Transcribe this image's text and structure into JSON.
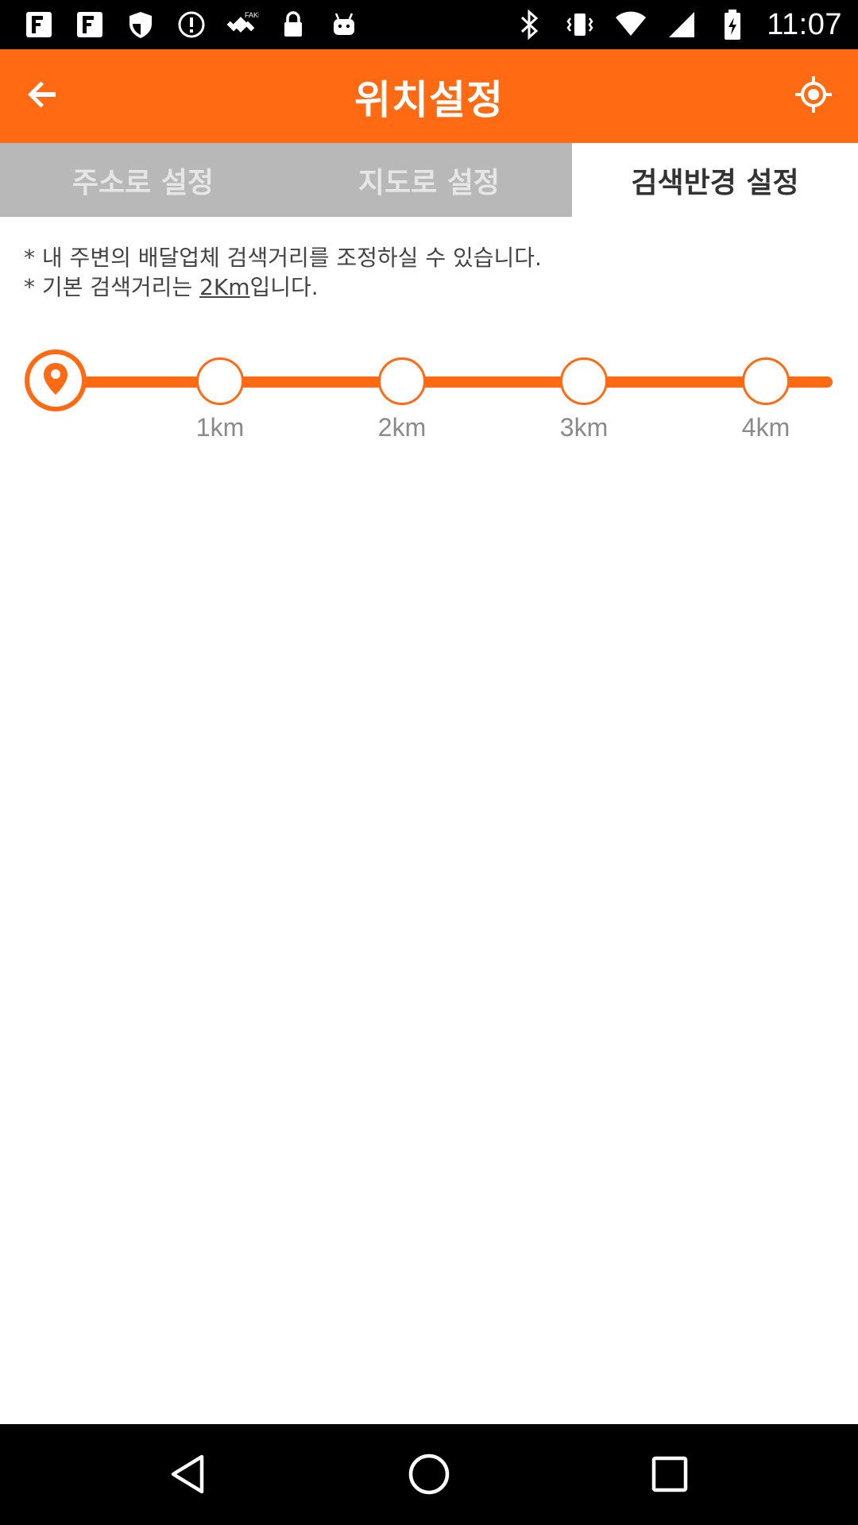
{
  "status_bar": {
    "time": "11:07",
    "left_icons": [
      "app-icon",
      "app-icon",
      "shield-icon",
      "alert-icon",
      "fake-gps-icon",
      "lock-icon",
      "android-icon"
    ],
    "right_icons": [
      "bluetooth-icon",
      "vibrate-icon",
      "wifi-icon",
      "signal-icon",
      "battery-icon"
    ]
  },
  "app_bar": {
    "title": "위치설정",
    "back_icon": "arrow-back-icon",
    "locate_icon": "my-location-icon",
    "color": "#ff6a13"
  },
  "tabs": [
    {
      "label": "주소로 설정",
      "active": false
    },
    {
      "label": "지도로 설정",
      "active": false
    },
    {
      "label": "검색반경 설정",
      "active": true
    }
  ],
  "notes": {
    "line1": "* 내 주변의 배달업체 검색거리를 조정하실 수 있습니다.",
    "line2_prefix": "* 기본 검색거리는 ",
    "line2_value": "2Km",
    "line2_suffix": "입니다."
  },
  "slider": {
    "stops": [
      "1km",
      "2km",
      "3km",
      "4km"
    ],
    "thumb_icon": "location-pin-icon"
  },
  "nav_bar": {
    "icons": [
      "back-triangle-icon",
      "home-circle-icon",
      "recents-square-icon"
    ]
  }
}
